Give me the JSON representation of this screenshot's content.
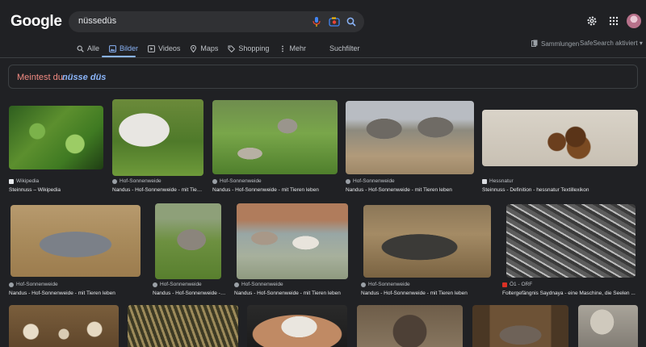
{
  "header": {
    "logo": "Google",
    "query": "nüssedüs"
  },
  "tabs": [
    {
      "label": "Alle",
      "icon": "search-icon",
      "active": false
    },
    {
      "label": "Bilder",
      "icon": "image-icon",
      "active": true
    },
    {
      "label": "Videos",
      "icon": "video-icon",
      "active": false
    },
    {
      "label": "Maps",
      "icon": "map-pin-icon",
      "active": false
    },
    {
      "label": "Shopping",
      "icon": "tag-icon",
      "active": false
    },
    {
      "label": "Mehr",
      "icon": "more-vertical-icon",
      "active": false
    }
  ],
  "toolbar": {
    "suchfilter": "Suchfilter",
    "sammlungen": "Sammlungen",
    "safesearch": "SafeSearch aktiviert"
  },
  "didyoumean": {
    "label": "Meintest du:",
    "suggestion": "nüsse düs"
  },
  "results": [
    {
      "source": "Wikipedia",
      "caption": "Steinnuss – Wikipedia",
      "fav": "wiki",
      "thumb": "jungle"
    },
    {
      "source": "Hof-Sonnenweide",
      "caption": "Nandus - Hof-Sonnenweide - mit Tieren leben",
      "fav": "hof",
      "thumb": "rhea-white"
    },
    {
      "source": "Hof-Sonnenweide",
      "caption": "Nandus - Hof-Sonnenweide - mit Tieren leben",
      "fav": "hof",
      "thumb": "field"
    },
    {
      "source": "Hof-Sonnenweide",
      "caption": "Nandus - Hof-Sonnenweide - mit Tieren leben",
      "fav": "hof",
      "thumb": "rhea-grey"
    },
    {
      "source": "Hessnatur",
      "caption": "Steinnuss - Definition - hessnatur Textillexikon",
      "fav": "hess",
      "thumb": "nuts"
    },
    {
      "source": "Hof-Sonnenweide",
      "caption": "Nandus - Hof-Sonnenweide - mit Tieren leben",
      "fav": "hof",
      "thumb": "rhea-hay"
    },
    {
      "source": "Hof-Sonnenweide",
      "caption": "Nandus - Hof-Sonnenweide - mit Tieren leben",
      "fav": "hof",
      "thumb": "rhea-walk"
    },
    {
      "source": "Hof-Sonnenweide",
      "caption": "Nandus - Hof-Sonnenweide - mit Tieren leben",
      "fav": "hof",
      "thumb": "rhea-two"
    },
    {
      "source": "Hof-Sonnenweide",
      "caption": "Nandus - Hof-Sonnenweide - mit Tieren leben",
      "fav": "hof",
      "thumb": "rhea-stall"
    },
    {
      "source": "Ö1 - ORF",
      "caption": "Foltergefängnis Saydnaya - eine Maschine, die Seelen ...",
      "fav": "orf",
      "thumb": "aerial"
    }
  ],
  "row3": [
    "mush",
    "palm",
    "hand",
    "hedge",
    "rhea-wood",
    "statue"
  ],
  "colors": {
    "accent": "#8ab4f8",
    "background": "#202124",
    "error": "#f28b82"
  }
}
